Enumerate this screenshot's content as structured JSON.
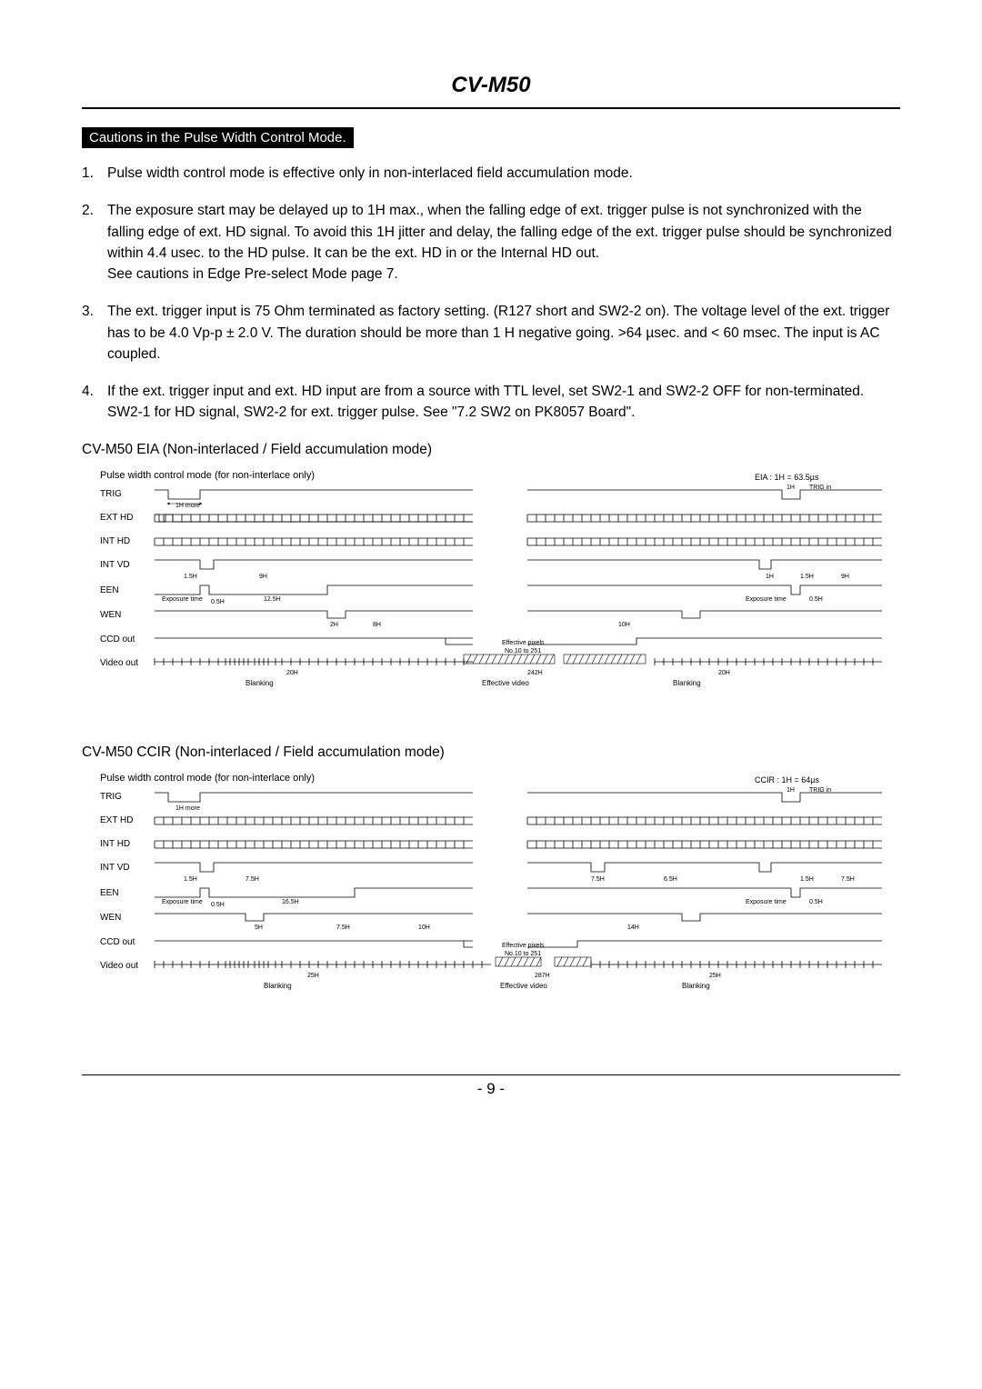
{
  "header": {
    "title": "CV-M50"
  },
  "cautions_heading": "Cautions in the Pulse Width Control Mode.",
  "cautions": [
    {
      "num": "1.",
      "text": "Pulse width control mode is effective only in non-interlaced field accumulation mode."
    },
    {
      "num": "2.",
      "text": "The exposure start may be delayed up to 1H max., when the falling edge of ext. trigger pulse is not synchronized with the falling edge of ext. HD signal. To avoid this 1H jitter and delay, the falling edge of the ext. trigger pulse should be synchronized within 4.4 usec. to the HD pulse. It can be the ext. HD in or the Internal HD out.\nSee cautions in Edge Pre-select Mode page 7."
    },
    {
      "num": "3.",
      "text": "The ext. trigger input is 75 Ohm terminated as factory setting. (R127 short and SW2-2 on). The voltage level of the ext. trigger has to be 4.0 Vp-p ± 2.0 V. The duration should be more than 1 H negative going. >64 µsec. and < 60 msec. The input is AC coupled."
    },
    {
      "num": "4.",
      "text": "If the ext. trigger input and ext. HD input are from a source with TTL level, set SW2-1 and SW2-2 OFF for non-terminated. SW2-1 for HD signal, SW2-2 for ext. trigger pulse. See \"7.2 SW2 on PK8057 Board\"."
    }
  ],
  "charts": [
    {
      "heading": "CV-M50 EIA (Non-interlaced /  Field accumulation mode)",
      "subtitle": "Pulse width control mode (for non-interlace only)",
      "ref": "EIA : 1H = 63.5µs",
      "signals": [
        "TRIG",
        "EXT HD",
        "INT HD",
        "INT VD",
        "EEN",
        "WEN",
        "CCD out",
        "Video out"
      ],
      "labels": {
        "trig_1h_more": "1H more",
        "trig_1h": "1H",
        "trig_in": "TRIG in",
        "vd_1_5h": "1.5H",
        "vd_9h": "9H",
        "vd_1h": "1H",
        "een_exp": "Exposure time",
        "een_0_5h": "0.5H",
        "een_12_5h": "12.5H",
        "een_0_5h_r": "0.5H",
        "wen_2h": "2H",
        "wen_8h": "8H",
        "wen_10h": "10H",
        "eff_pixels": "Effective pixels",
        "no_range": "No.10 to 251",
        "vo_20h": "20H",
        "vo_242h": "242H",
        "blanking": "Blanking",
        "eff_video": "Effective video"
      }
    },
    {
      "heading": "CV-M50 CCIR (Non-interlaced /  Field accumulation mode)",
      "subtitle": "Pulse width control mode (for non-interlace only)",
      "ref": "CCIR : 1H = 64µs",
      "signals": [
        "TRIG",
        "EXT HD",
        "INT HD",
        "INT VD",
        "EEN",
        "WEN",
        "CCD out",
        "Video out"
      ],
      "labels": {
        "trig_1h_more": "1H more",
        "trig_1h": "1H",
        "trig_in": "TRIG in",
        "vd_1_5h": "1.5H",
        "vd_7_5h": "7.5H",
        "vd_1_5h_r": "1.5H",
        "vd_6_5h": "6.5H",
        "een_exp": "Exposure time",
        "een_0_5h": "0.5H",
        "een_16_5h": "16.5H",
        "een_0_5h_r": "0.5H",
        "wen_5h": "5H",
        "wen_7_5h": "7.5H",
        "wen_10h": "10H",
        "wen_14h": "14H",
        "eff_pixels": "Effective pixels",
        "no_range": "No.10 to 251",
        "vo_25h": "25H",
        "vo_287h": "287H",
        "blanking": "Blanking",
        "eff_video": "Effective video"
      }
    }
  ],
  "footer": {
    "page_num": "- 9 -"
  },
  "chart_data": [
    {
      "type": "table",
      "title": "CV-M50 EIA Pulse width control mode timing",
      "reference": "1H = 63.5µs",
      "rows": [
        {
          "signal": "TRIG",
          "values": [
            "1H more (min pulse width)",
            "1H",
            "TRIG in"
          ]
        },
        {
          "signal": "EXT HD",
          "values": [
            "continuous HD pulses"
          ]
        },
        {
          "signal": "INT HD",
          "values": [
            "continuous HD pulses"
          ]
        },
        {
          "signal": "INT VD",
          "values": [
            "1.5H",
            "9H",
            "1H",
            "1.5H",
            "9H"
          ]
        },
        {
          "signal": "EEN",
          "values": [
            "Exposure time",
            "0.5H",
            "12.5H",
            "Exposure time",
            "0.5H"
          ]
        },
        {
          "signal": "WEN",
          "values": [
            "2H",
            "8H",
            "10H"
          ]
        },
        {
          "signal": "CCD out",
          "values": [
            "Effective pixels No.10 to 251"
          ]
        },
        {
          "signal": "Video out",
          "values": [
            "20H Blanking",
            "242H Effective video",
            "20H Blanking"
          ]
        }
      ]
    },
    {
      "type": "table",
      "title": "CV-M50 CCIR Pulse width control mode timing",
      "reference": "1H = 64µs",
      "rows": [
        {
          "signal": "TRIG",
          "values": [
            "1H more (min pulse width)",
            "1H",
            "TRIG in"
          ]
        },
        {
          "signal": "EXT HD",
          "values": [
            "continuous HD pulses"
          ]
        },
        {
          "signal": "INT HD",
          "values": [
            "continuous HD pulses"
          ]
        },
        {
          "signal": "INT VD",
          "values": [
            "1.5H",
            "7.5H",
            "7.5H",
            "6.5H",
            "1.5H",
            "7.5H"
          ]
        },
        {
          "signal": "EEN",
          "values": [
            "Exposure time",
            "0.5H",
            "16.5H",
            "Exposure time",
            "0.5H"
          ]
        },
        {
          "signal": "WEN",
          "values": [
            "5H",
            "7.5H",
            "10H",
            "14H"
          ]
        },
        {
          "signal": "CCD out",
          "values": [
            "Effective pixels No.10 to 251"
          ]
        },
        {
          "signal": "Video out",
          "values": [
            "25H Blanking",
            "287H Effective video",
            "25H Blanking"
          ]
        }
      ]
    }
  ]
}
